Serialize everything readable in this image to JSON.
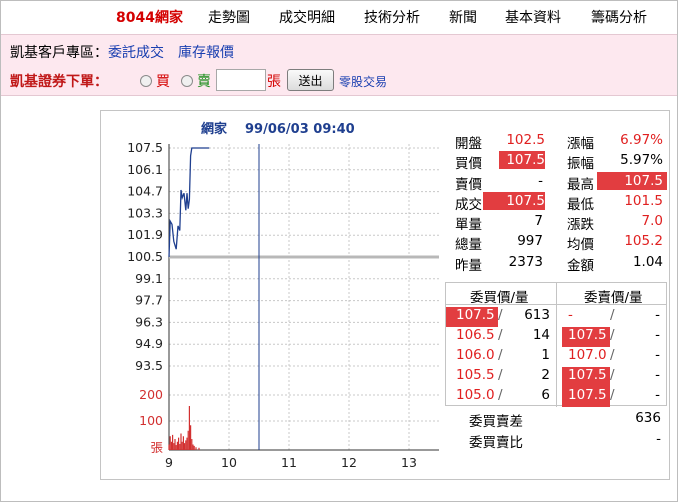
{
  "nav": {
    "title": "8044網家",
    "items": [
      "走勢圖",
      "成交明細",
      "技術分析",
      "新聞",
      "基本資料",
      "籌碼分析"
    ]
  },
  "broker": {
    "zone_label": "凱基客戶專區：",
    "link1": "委託成交",
    "link2": "庫存報價",
    "order_label": "凱基證券下單：",
    "buy_label": "買",
    "sell_label": "賣",
    "qty_value": "",
    "unit_label": "張",
    "send_label": "送出",
    "odd_lot_label": "零股交易"
  },
  "chart_data": {
    "type": "line",
    "title": "網家",
    "timestamp": "99/06/03 09:40",
    "price_ticks": [
      "107.5",
      "106.1",
      "104.7",
      "103.3",
      "101.9",
      "100.5",
      "99.1",
      "97.7",
      "96.3",
      "94.9",
      "93.5"
    ],
    "volume_ticks": [
      "200",
      "100",
      "張"
    ],
    "x_ticks": [
      "9",
      "10",
      "11",
      "12",
      "13"
    ],
    "reference_price": 100.5,
    "ylim": [
      93.5,
      107.5
    ],
    "xlim": [
      9,
      13.5
    ],
    "current_time": 10.5,
    "price_series": [
      {
        "x": 9.0,
        "y": 100.5
      },
      {
        "x": 9.02,
        "y": 102.8
      },
      {
        "x": 9.05,
        "y": 102.6
      },
      {
        "x": 9.08,
        "y": 101.5
      },
      {
        "x": 9.12,
        "y": 101.0
      },
      {
        "x": 9.15,
        "y": 102.5
      },
      {
        "x": 9.18,
        "y": 102.2
      },
      {
        "x": 9.2,
        "y": 104.8
      },
      {
        "x": 9.22,
        "y": 104.3
      },
      {
        "x": 9.25,
        "y": 104.6
      },
      {
        "x": 9.28,
        "y": 103.5
      },
      {
        "x": 9.3,
        "y": 104.6
      },
      {
        "x": 9.32,
        "y": 103.6
      },
      {
        "x": 9.34,
        "y": 104.2
      },
      {
        "x": 9.36,
        "y": 107.0
      },
      {
        "x": 9.38,
        "y": 107.5
      },
      {
        "x": 9.67,
        "y": 107.5
      }
    ],
    "volume_series": [
      {
        "x": 9.0,
        "v": 20
      },
      {
        "x": 9.02,
        "v": 50
      },
      {
        "x": 9.04,
        "v": 30
      },
      {
        "x": 9.06,
        "v": 55
      },
      {
        "x": 9.08,
        "v": 25
      },
      {
        "x": 9.1,
        "v": 40
      },
      {
        "x": 9.12,
        "v": 18
      },
      {
        "x": 9.14,
        "v": 30
      },
      {
        "x": 9.16,
        "v": 45
      },
      {
        "x": 9.18,
        "v": 22
      },
      {
        "x": 9.2,
        "v": 60
      },
      {
        "x": 9.22,
        "v": 30
      },
      {
        "x": 9.24,
        "v": 50
      },
      {
        "x": 9.26,
        "v": 25
      },
      {
        "x": 9.28,
        "v": 35
      },
      {
        "x": 9.3,
        "v": 45
      },
      {
        "x": 9.32,
        "v": 70
      },
      {
        "x": 9.34,
        "v": 160
      },
      {
        "x": 9.36,
        "v": 90
      },
      {
        "x": 9.38,
        "v": 40
      },
      {
        "x": 9.4,
        "v": 20
      },
      {
        "x": 9.42,
        "v": 15
      },
      {
        "x": 9.45,
        "v": 10
      },
      {
        "x": 9.5,
        "v": 8
      }
    ]
  },
  "quote": {
    "open_label": "開盤",
    "open": "102.5",
    "change_pct_label": "漲幅",
    "change_pct": "6.97%",
    "bid_label": "買價",
    "bid": "107.5",
    "amplitude_label": "振幅",
    "amplitude": "5.97%",
    "ask_label": "賣價",
    "ask": "-",
    "high_label": "最高",
    "high": "107.5",
    "last_label": "成交",
    "last": "107.5",
    "low_label": "最低",
    "low": "101.5",
    "tick_vol_label": "單量",
    "tick_vol": "7",
    "change_label": "漲跌",
    "change": "7.0",
    "total_vol_label": "總量",
    "total_vol": "997",
    "avg_label": "均價",
    "avg": "105.2",
    "prev_close_label": "昨量",
    "prev_close": "2373",
    "amount_label": "金額",
    "amount": "1.04"
  },
  "book": {
    "bid_header": "委買價/量",
    "ask_header": "委賣價/量",
    "rows": [
      {
        "bid_price": "107.5",
        "bid_qty": "613",
        "ask_price": "-",
        "ask_qty": "-"
      },
      {
        "bid_price": "106.5",
        "bid_qty": "14",
        "ask_price": "107.5",
        "ask_qty": "-"
      },
      {
        "bid_price": "106.0",
        "bid_qty": "1",
        "ask_price": "107.0",
        "ask_qty": "-"
      },
      {
        "bid_price": "105.5",
        "bid_qty": "2",
        "ask_price": "107.5",
        "ask_qty": "-"
      },
      {
        "bid_price": "105.0",
        "bid_qty": "6",
        "ask_price": "107.5",
        "ask_qty": "-"
      }
    ],
    "diff_label": "委買賣差",
    "diff": "636",
    "ratio_label": "委買賣比",
    "ratio": "-"
  },
  "colors": {
    "accent": "#d40000",
    "highlight": "#e23d40",
    "link": "#1a3fb0",
    "band": "#fde8ef",
    "line": "#1f3f8f"
  }
}
